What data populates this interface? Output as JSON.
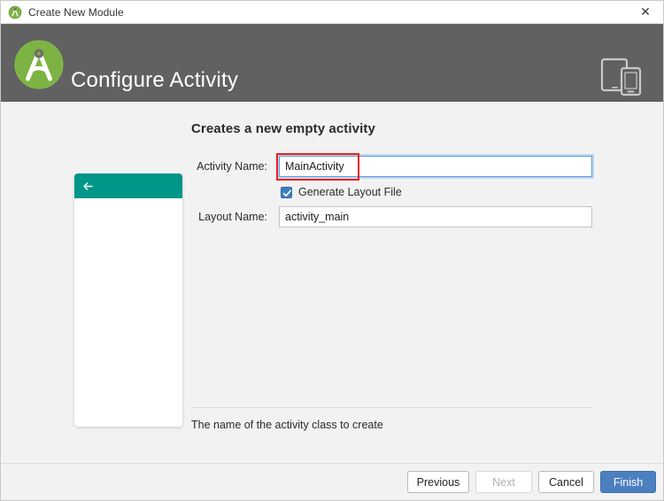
{
  "titlebar": {
    "title": "Create New Module",
    "icon": "android-studio-icon",
    "close_label": "✕"
  },
  "header": {
    "title": "Configure Activity",
    "logo": "android-studio-logo",
    "device_icon": "tablet-and-phone-icon",
    "background_color": "#616161"
  },
  "content": {
    "heading": "Creates a new empty activity",
    "preview": {
      "appbar_color": "#009688",
      "back_icon": "back-arrow-icon"
    },
    "fields": {
      "activity_name": {
        "label": "Activity Name:",
        "value": "MainActivity",
        "focused": true
      },
      "layout_name": {
        "label": "Layout Name:",
        "value": "activity_main",
        "focused": false
      }
    },
    "checkbox": {
      "label": "Generate Layout File",
      "checked": true,
      "color": "#3d7fc1"
    },
    "annotation": {
      "color": "#ee1b1b",
      "target": "activity-name-value"
    },
    "help_text": "The name of the activity class to create"
  },
  "footer": {
    "buttons": {
      "previous": "Previous",
      "next": "Next",
      "cancel": "Cancel",
      "finish": "Finish"
    },
    "finish_color": "#4b7fc0"
  }
}
